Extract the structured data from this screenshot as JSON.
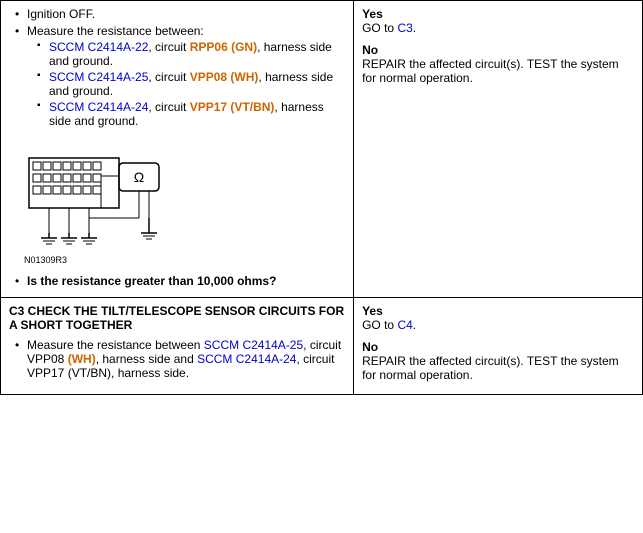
{
  "row1": {
    "left": {
      "ignition": "Ignition OFF.",
      "measure_intro": "Measure the resistance between:",
      "bullets": [
        {
          "main": "SCCM C2414A-22, circuit RPP06 (GN), harness side and ground.",
          "link_text": "SCCM C2414A-22",
          "link_target": "",
          "circuit": "RPP06 (GN)",
          "rest": ", harness side and ground."
        },
        {
          "main": "SCCM C2414A-25, circuit VPP08 (WH), harness side and ground.",
          "link_text": "SCCM C2414A-25",
          "circuit": "VPP08 (WH)",
          "rest": ", harness side and ground."
        },
        {
          "main": "SCCM C2414A-24, circuit VPP17 (VT/BN), harness side and ground.",
          "link_text": "SCCM C2414A-24",
          "circuit": "VPP17 (VT/BN)",
          "rest": ", harness side and ground."
        }
      ],
      "diagram_label": "N01309R3",
      "question": "Is the resistance greater than 10,000 ohms?"
    },
    "right": {
      "yes_label": "Yes",
      "yes_action": "GO to ",
      "yes_link": "C3",
      "no_label": "No",
      "no_action": "REPAIR the affected circuit(s). TEST the system for normal operation."
    }
  },
  "row2": {
    "left": {
      "header": "C3 CHECK THE TILT/TELESCOPE SENSOR CIRCUITS FOR A SHORT TOGETHER",
      "measure_intro": "Measure the resistance between",
      "bullet_parts": {
        "link1": "SCCM C2414A-25",
        "circuit1": ", circuit VPP08",
        "orange1": "(WH)",
        "middle": ", harness side and ",
        "link2": "SCCM C2414A-24",
        "circuit2": ", circuit VPP17 (VT/BN),",
        "end": " harness side."
      }
    },
    "right": {
      "yes_label": "Yes",
      "yes_action": "GO to ",
      "yes_link": "C4",
      "no_label": "No",
      "no_action": "REPAIR the affected circuit(s). TEST the system for normal operation."
    }
  }
}
